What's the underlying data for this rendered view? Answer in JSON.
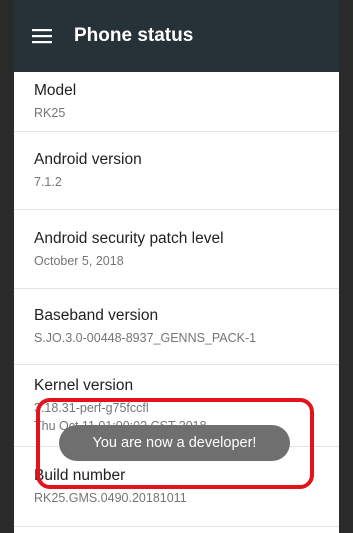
{
  "appbar": {
    "title": "Phone status",
    "menu_icon": "hamburger-menu-icon"
  },
  "items": [
    {
      "title": "Model",
      "value": "RK25"
    },
    {
      "title": "Android version",
      "value": "7.1.2"
    },
    {
      "title": "Android security patch level",
      "value": "October 5, 2018"
    },
    {
      "title": "Baseband version",
      "value": "S.JO.3.0-00448-8937_GENNS_PACK-1"
    },
    {
      "title": "Kernel version",
      "value": "3.18.31-perf-g75fccfl",
      "value2": "Thu Oct 11 01:00:02 CST 2018"
    },
    {
      "title": "Build number",
      "value": "RK25.GMS.0490.20181011"
    }
  ],
  "toast": {
    "text": "You are now a developer!"
  },
  "colors": {
    "appbar": "#263238",
    "highlight": "#e3121b",
    "toast": "#6f6f6f"
  }
}
